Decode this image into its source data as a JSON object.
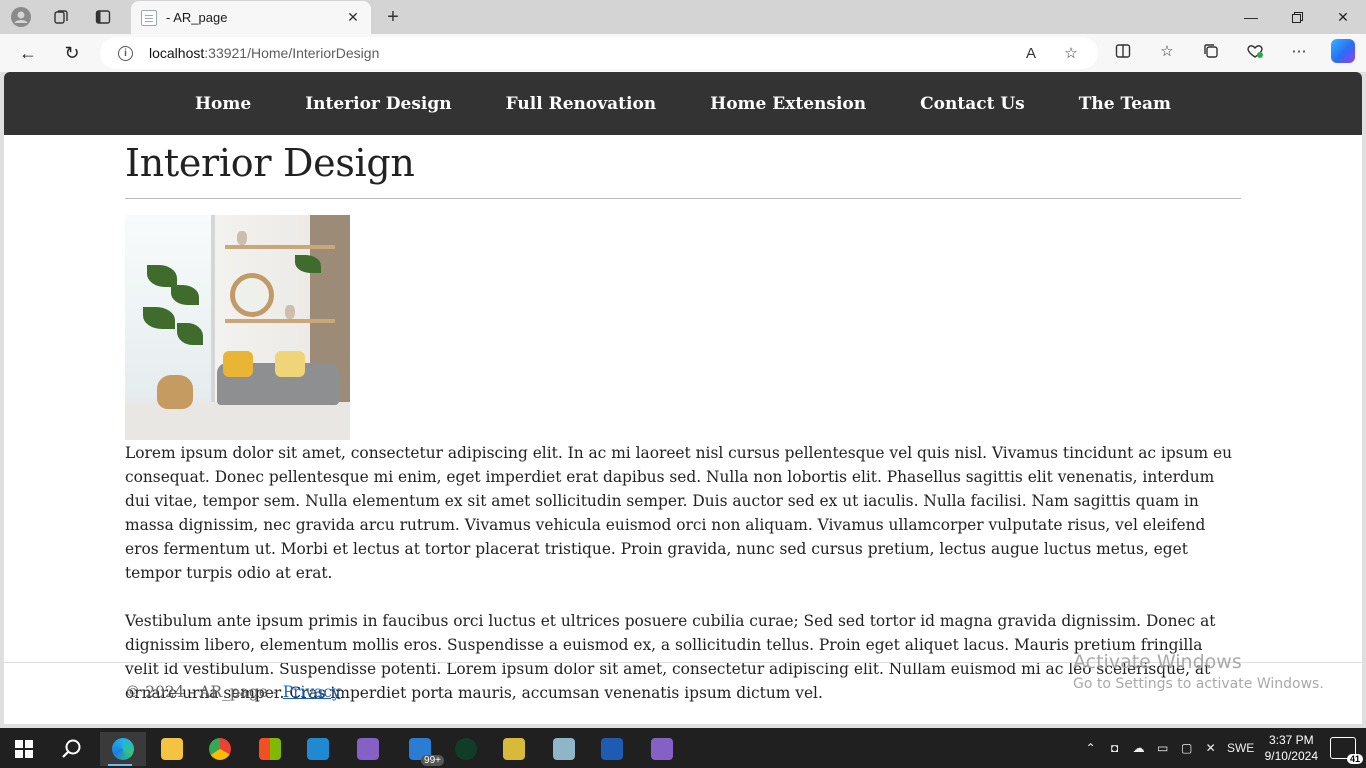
{
  "browser": {
    "tab_title": "- AR_page",
    "url_host": "localhost",
    "url_rest": ":33921/Home/InteriorDesign"
  },
  "site": {
    "nav": [
      {
        "label": "Home"
      },
      {
        "label": "Interior Design"
      },
      {
        "label": "Full Renovation"
      },
      {
        "label": "Home Extension"
      },
      {
        "label": "Contact Us"
      },
      {
        "label": "The Team"
      }
    ],
    "page_title": "Interior Design",
    "paragraphs": [
      "Lorem ipsum dolor sit amet, consectetur adipiscing elit. In ac mi laoreet nisl cursus pellentesque vel quis nisl. Vivamus tincidunt ac ipsum eu consequat. Donec pellentesque mi enim, eget imperdiet erat dapibus sed. Nulla non lobortis elit. Phasellus sagittis elit venenatis, interdum dui vitae, tempor sem. Nulla elementum ex sit amet sollicitudin semper. Duis auctor sed ex ut iaculis. Nulla facilisi. Nam sagittis quam in massa dignissim, nec gravida arcu rutrum. Vivamus vehicula euismod orci non aliquam. Vivamus ullamcorper vulputate risus, vel eleifend eros fermentum ut. Morbi et lectus at tortor placerat tristique. Proin gravida, nunc sed cursus pretium, lectus augue luctus metus, eget tempor turpis odio at erat.",
      "Vestibulum ante ipsum primis in faucibus orci luctus et ultrices posuere cubilia curae; Sed sed tortor id magna gravida dignissim. Donec at dignissim libero, elementum mollis eros. Suspendisse a euismod ex, a sollicitudin tellus. Proin eget aliquet lacus. Mauris pretium fringilla velit id vestibulum. Suspendisse potenti. Lorem ipsum dolor sit amet, consectetur adipiscing elit. Nullam euismod mi ac leo scelerisque, at ornare urna semper. Cras imperdiet porta mauris, accumsan venenatis ipsum dictum vel."
    ],
    "footer_text": "© 2024 - AR_page - ",
    "footer_link": "Privacy"
  },
  "watermark": {
    "title": "Activate Windows",
    "subtitle": "Go to Settings to activate Windows."
  },
  "taskbar": {
    "badge_count": "99+",
    "language": "SWE",
    "time": "3:37 PM",
    "date": "9/10/2024",
    "notifications": "41"
  },
  "colors": {
    "nav_bg": "#333333",
    "link": "#1d5fb4"
  }
}
